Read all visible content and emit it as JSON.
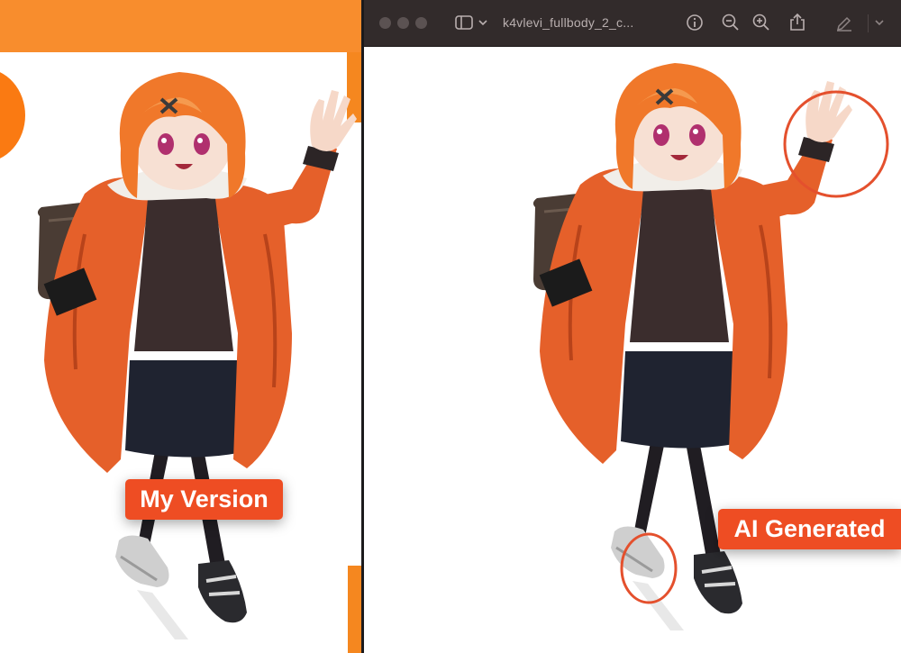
{
  "left_window": {
    "label": "My Version",
    "colors": {
      "header": "#f88d2d",
      "accent_circle": "#fa7a12",
      "edge": "#f5871f"
    }
  },
  "right_window": {
    "title": "k4vlevi_fullbody_2_c...",
    "toolbar_icons": [
      "sidebar-toggle-icon",
      "chevron-down-icon",
      "info-icon",
      "zoom-out-icon",
      "zoom-in-icon",
      "share-icon",
      "markup-pen-icon",
      "chevron-down-icon"
    ],
    "label": "AI Generated",
    "colors": {
      "titlebar": "#322b2b",
      "traffic_light": "#5b5252"
    }
  },
  "annotations": {
    "color": "#e4502d",
    "circled_regions": [
      "raised-hand",
      "shoe"
    ]
  },
  "colors": {
    "label_background": "#ee4d23",
    "label_text": "#ffffff",
    "hair": "#f0782a",
    "jacket": "#e5602a",
    "sweater": "#3b2d2d",
    "skirt": "#1f2330"
  }
}
